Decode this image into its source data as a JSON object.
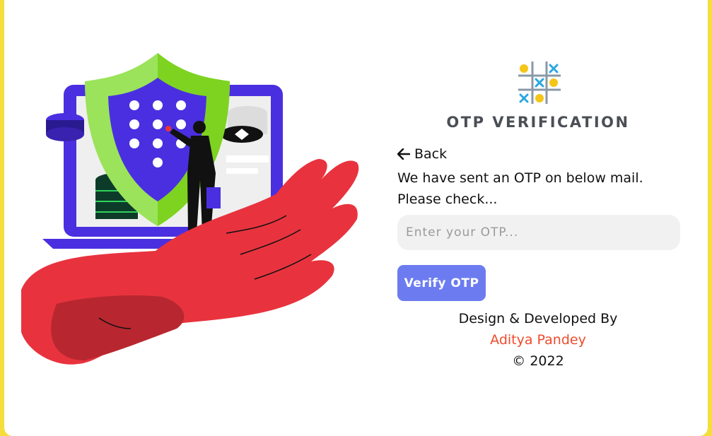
{
  "header": {
    "title": "OTP VERIFICATION"
  },
  "nav": {
    "back_label": "Back"
  },
  "form": {
    "message_line1": "We have sent an OTP on below mail.",
    "message_line2": "Please check...",
    "otp_placeholder": "Enter your OTP...",
    "verify_label": "Verify OTP"
  },
  "footer": {
    "credit": "Design & Developed By",
    "author": "Aditya Pandey",
    "copyright": "© 2022"
  },
  "colors": {
    "background": "#f5dd3a",
    "card": "#ffffff",
    "accent_button": "#6c7cf0",
    "author": "#ee4b2b",
    "title": "#4b4f55"
  },
  "icons": [
    "tic-tac-toe-logo-icon",
    "arrow-left-icon",
    "security-illustration"
  ]
}
